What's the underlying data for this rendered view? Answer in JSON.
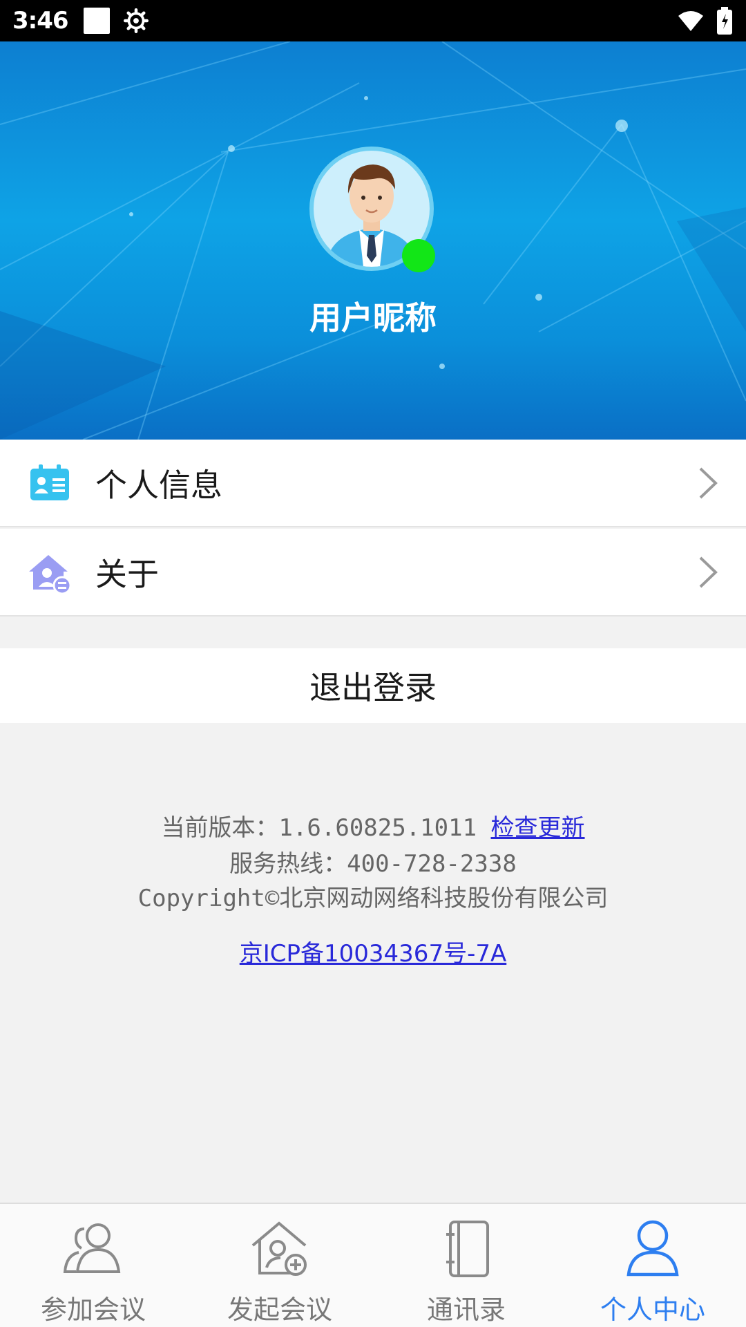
{
  "status_bar": {
    "time": "3:46"
  },
  "profile": {
    "nickname": "用户昵称",
    "online_color": "#12e617"
  },
  "menu": {
    "items": [
      {
        "label": "个人信息",
        "icon": "id-card-icon"
      },
      {
        "label": "关于",
        "icon": "house-user-icon"
      }
    ],
    "logout_label": "退出登录"
  },
  "footer": {
    "version_text": "当前版本：1.6.60825.1011 ",
    "check_update": "检查更新",
    "hotline": "服务热线：400-728-2338",
    "copyright": "Copyright©北京网动网络科技股份有限公司",
    "icp": "京ICP备10034367号-7A"
  },
  "bottom_nav": {
    "items": [
      {
        "label": "参加会议",
        "icon": "users-icon"
      },
      {
        "label": "发起会议",
        "icon": "house-plus-icon"
      },
      {
        "label": "通讯录",
        "icon": "address-book-icon"
      },
      {
        "label": "个人中心",
        "icon": "person-icon"
      }
    ],
    "active_label": "个人中心",
    "active_color": "#2d7ef0"
  }
}
